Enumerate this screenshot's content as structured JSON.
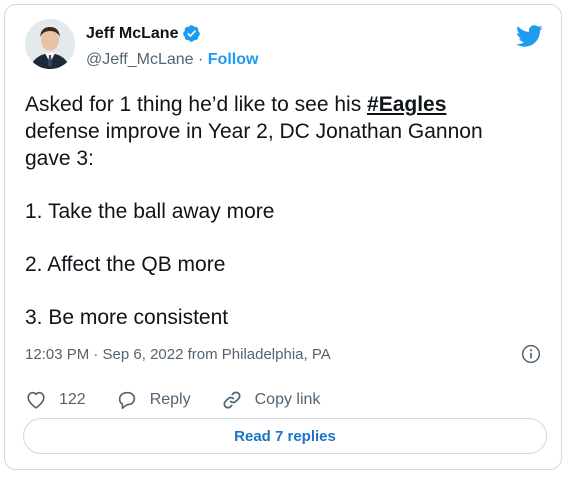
{
  "author": {
    "name": "Jeff McLane",
    "handle": "@Jeff_McLane",
    "separator": " · ",
    "follow_label": "Follow"
  },
  "tweet": {
    "line1_prefix": "Asked for 1 thing he’d like to see his ",
    "hashtag": "#Eagles",
    "line2": "defense improve in Year 2, DC Jonathan Gannon",
    "line3": "gave 3:",
    "items": [
      "1. Take the ball away more",
      "2. Affect the QB more",
      "3. Be more consistent"
    ]
  },
  "meta": {
    "timestamp": "12:03 PM · Sep 6, 2022 from Philadelphia, PA"
  },
  "actions": {
    "like_count": "122",
    "reply_label": "Reply",
    "copy_link_label": "Copy link"
  },
  "read_replies_label": "Read 7 replies",
  "colors": {
    "accent": "#1d9bf0",
    "muted": "#536471",
    "border": "#cfd9de"
  },
  "icons": [
    "verified-badge-icon",
    "twitter-bird-icon",
    "info-icon",
    "heart-icon",
    "reply-icon",
    "link-icon"
  ]
}
